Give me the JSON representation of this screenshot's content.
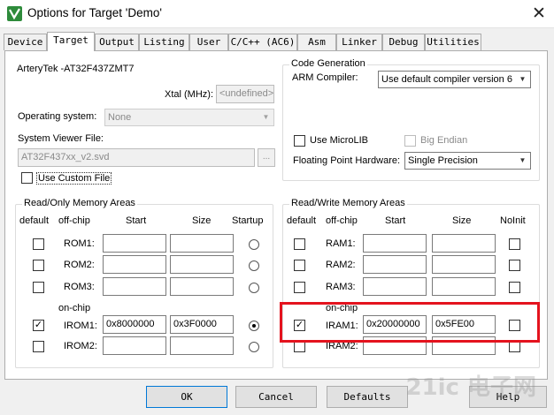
{
  "window": {
    "title": "Options for Target 'Demo'",
    "close_glyph": "✕",
    "icon": "keil-app-icon"
  },
  "tabs": [
    "Device",
    "Target",
    "Output",
    "Listing",
    "User",
    "C/C++ (AC6)",
    "Asm",
    "Linker",
    "Debug",
    "Utilities"
  ],
  "active_tab": "Target",
  "target": {
    "device_name": "ArteryTek -AT32F437ZMT7",
    "xtal_label": "Xtal (MHz):",
    "xtal_value": "<undefined>",
    "os_label": "Operating system:",
    "os_value": "None",
    "svd_label": "System Viewer File:",
    "svd_value": "AT32F437xx_v2.svd",
    "browse_label": "...",
    "custom_file_label": "Use Custom File"
  },
  "code_generation": {
    "title": "Code Generation",
    "compiler_label": "ARM Compiler:",
    "compiler_value": "Use default compiler version 6",
    "microlib_label": "Use MicroLIB",
    "big_endian_label": "Big Endian",
    "fpu_label": "Floating Point Hardware:",
    "fpu_value": "Single Precision"
  },
  "rom_areas": {
    "title": "Read/Only Memory Areas",
    "headers": {
      "default": "default",
      "offchip": "off-chip",
      "start": "Start",
      "size": "Size",
      "startup": "Startup"
    },
    "onchip_label": "on-chip",
    "rows": [
      {
        "name": "ROM1:",
        "start": "",
        "size": "",
        "default": false,
        "startup": false
      },
      {
        "name": "ROM2:",
        "start": "",
        "size": "",
        "default": false,
        "startup": false
      },
      {
        "name": "ROM3:",
        "start": "",
        "size": "",
        "default": false,
        "startup": false
      },
      {
        "name": "IROM1:",
        "start": "0x8000000",
        "size": "0x3F0000",
        "default": true,
        "startup": true
      },
      {
        "name": "IROM2:",
        "start": "",
        "size": "",
        "default": false,
        "startup": false
      }
    ]
  },
  "ram_areas": {
    "title": "Read/Write Memory Areas",
    "headers": {
      "default": "default",
      "offchip": "off-chip",
      "start": "Start",
      "size": "Size",
      "noinit": "NoInit"
    },
    "onchip_label": "on-chip",
    "rows": [
      {
        "name": "RAM1:",
        "start": "",
        "size": "",
        "default": false,
        "noinit": false
      },
      {
        "name": "RAM2:",
        "start": "",
        "size": "",
        "default": false,
        "noinit": false
      },
      {
        "name": "RAM3:",
        "start": "",
        "size": "",
        "default": false,
        "noinit": false
      },
      {
        "name": "IRAM1:",
        "start": "0x20000000",
        "size": "0x5FE00",
        "default": true,
        "noinit": false
      },
      {
        "name": "IRAM2:",
        "start": "",
        "size": "",
        "default": false,
        "noinit": false
      }
    ]
  },
  "buttons": {
    "ok": "OK",
    "cancel": "Cancel",
    "defaults": "Defaults",
    "help": "Help"
  },
  "watermark": "21ic 电子网",
  "colors": {
    "highlight": "#e4131e",
    "app_icon": "#2e8b3b",
    "focus": "#0078d7"
  }
}
